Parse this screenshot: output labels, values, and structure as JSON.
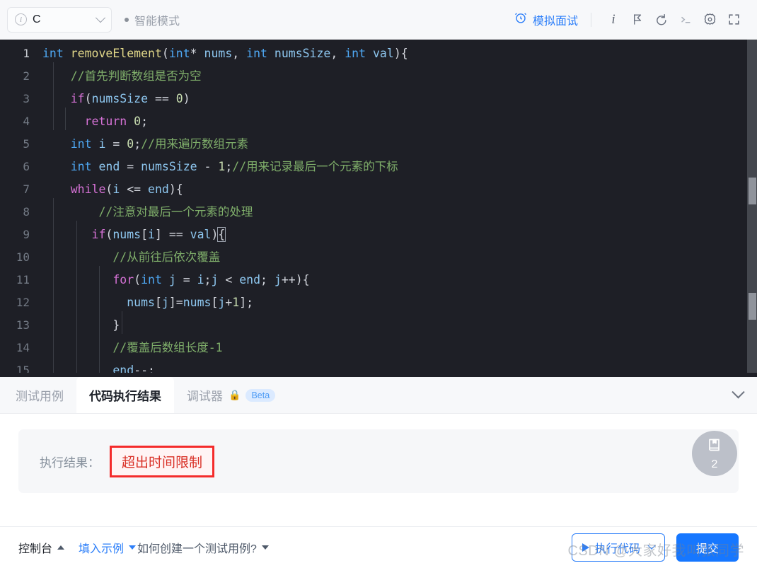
{
  "toolbar": {
    "language": "C",
    "info_icon": "info-circle-icon",
    "dropdown_icon": "chevron-down-icon",
    "mode_label": "智能模式",
    "mock_interview_label": "模拟面试",
    "mock_interview_icon": "alarm-clock-icon",
    "accent_color": "#2d7ff9",
    "icons": [
      {
        "name": "info-italic-icon",
        "glyph": "i"
      },
      {
        "name": "flag-run-icon",
        "glyph": "flag"
      },
      {
        "name": "undo-reset-icon",
        "glyph": "undo"
      },
      {
        "name": "terminal-icon",
        "glyph": ">_"
      },
      {
        "name": "settings-gear-icon",
        "glyph": "gear"
      },
      {
        "name": "fullscreen-icon",
        "glyph": "fullscreen"
      }
    ]
  },
  "editor": {
    "background": "#1e1f26",
    "active_line": 1,
    "lines": [
      {
        "n": "1",
        "tokens": [
          {
            "t": "kw",
            "s": "int"
          },
          {
            "t": "op",
            "s": " "
          },
          {
            "t": "fn",
            "s": "removeElement"
          },
          {
            "t": "punc",
            "s": "("
          },
          {
            "t": "kw",
            "s": "int"
          },
          {
            "t": "op",
            "s": "* "
          },
          {
            "t": "var",
            "s": "nums"
          },
          {
            "t": "punc",
            "s": ", "
          },
          {
            "t": "kw",
            "s": "int"
          },
          {
            "t": "op",
            "s": " "
          },
          {
            "t": "var",
            "s": "numsSize"
          },
          {
            "t": "punc",
            "s": ", "
          },
          {
            "t": "kw",
            "s": "int"
          },
          {
            "t": "op",
            "s": " "
          },
          {
            "t": "var",
            "s": "val"
          },
          {
            "t": "punc",
            "s": "){"
          }
        ]
      },
      {
        "n": "2",
        "tokens": [
          {
            "t": "op",
            "s": "    "
          },
          {
            "t": "cmt",
            "s": "//首先判断数组是否为空"
          }
        ]
      },
      {
        "n": "3",
        "tokens": [
          {
            "t": "op",
            "s": "    "
          },
          {
            "t": "ctl",
            "s": "if"
          },
          {
            "t": "punc",
            "s": "("
          },
          {
            "t": "var",
            "s": "numsSize"
          },
          {
            "t": "op",
            "s": " == "
          },
          {
            "t": "num",
            "s": "0"
          },
          {
            "t": "punc",
            "s": ")"
          }
        ]
      },
      {
        "n": "4",
        "tokens": [
          {
            "t": "op",
            "s": "      "
          },
          {
            "t": "ctl",
            "s": "return"
          },
          {
            "t": "op",
            "s": " "
          },
          {
            "t": "num",
            "s": "0"
          },
          {
            "t": "punc",
            "s": ";"
          }
        ]
      },
      {
        "n": "5",
        "tokens": [
          {
            "t": "op",
            "s": "    "
          },
          {
            "t": "kw",
            "s": "int"
          },
          {
            "t": "op",
            "s": " "
          },
          {
            "t": "var",
            "s": "i"
          },
          {
            "t": "op",
            "s": " = "
          },
          {
            "t": "num",
            "s": "0"
          },
          {
            "t": "punc",
            "s": ";"
          },
          {
            "t": "cmt",
            "s": "//用来遍历数组元素"
          }
        ]
      },
      {
        "n": "6",
        "tokens": [
          {
            "t": "op",
            "s": "    "
          },
          {
            "t": "kw",
            "s": "int"
          },
          {
            "t": "op",
            "s": " "
          },
          {
            "t": "var",
            "s": "end"
          },
          {
            "t": "op",
            "s": " = "
          },
          {
            "t": "var",
            "s": "numsSize"
          },
          {
            "t": "op",
            "s": " - "
          },
          {
            "t": "num",
            "s": "1"
          },
          {
            "t": "punc",
            "s": ";"
          },
          {
            "t": "cmt",
            "s": "//用来记录最后一个元素的下标"
          }
        ]
      },
      {
        "n": "7",
        "tokens": [
          {
            "t": "op",
            "s": "    "
          },
          {
            "t": "ctl",
            "s": "while"
          },
          {
            "t": "punc",
            "s": "("
          },
          {
            "t": "var",
            "s": "i"
          },
          {
            "t": "op",
            "s": " <= "
          },
          {
            "t": "var",
            "s": "end"
          },
          {
            "t": "punc",
            "s": "){"
          }
        ]
      },
      {
        "n": "8",
        "tokens": [
          {
            "t": "op",
            "s": "        "
          },
          {
            "t": "cmt",
            "s": "//注意对最后一个元素的处理"
          }
        ]
      },
      {
        "n": "9",
        "tokens": [
          {
            "t": "op",
            "s": "       "
          },
          {
            "t": "ctl",
            "s": "if"
          },
          {
            "t": "punc",
            "s": "("
          },
          {
            "t": "var",
            "s": "nums"
          },
          {
            "t": "punc",
            "s": "["
          },
          {
            "t": "var",
            "s": "i"
          },
          {
            "t": "punc",
            "s": "]"
          },
          {
            "t": "op",
            "s": " == "
          },
          {
            "t": "var",
            "s": "val"
          },
          {
            "t": "punc",
            "s": ")"
          },
          {
            "t": "box",
            "s": "{"
          }
        ]
      },
      {
        "n": "10",
        "tokens": [
          {
            "t": "op",
            "s": "          "
          },
          {
            "t": "cmt",
            "s": "//从前往后依次覆盖"
          }
        ]
      },
      {
        "n": "11",
        "tokens": [
          {
            "t": "op",
            "s": "          "
          },
          {
            "t": "ctl",
            "s": "for"
          },
          {
            "t": "punc",
            "s": "("
          },
          {
            "t": "kw",
            "s": "int"
          },
          {
            "t": "op",
            "s": " "
          },
          {
            "t": "var",
            "s": "j"
          },
          {
            "t": "op",
            "s": " = "
          },
          {
            "t": "var",
            "s": "i"
          },
          {
            "t": "punc",
            "s": ";"
          },
          {
            "t": "var",
            "s": "j"
          },
          {
            "t": "op",
            "s": " < "
          },
          {
            "t": "var",
            "s": "end"
          },
          {
            "t": "punc",
            "s": "; "
          },
          {
            "t": "var",
            "s": "j"
          },
          {
            "t": "op",
            "s": "++"
          },
          {
            "t": "punc",
            "s": "){"
          }
        ]
      },
      {
        "n": "12",
        "tokens": [
          {
            "t": "op",
            "s": "            "
          },
          {
            "t": "var",
            "s": "nums"
          },
          {
            "t": "punc",
            "s": "["
          },
          {
            "t": "var",
            "s": "j"
          },
          {
            "t": "punc",
            "s": "]"
          },
          {
            "t": "op",
            "s": "="
          },
          {
            "t": "var",
            "s": "nums"
          },
          {
            "t": "punc",
            "s": "["
          },
          {
            "t": "var",
            "s": "j"
          },
          {
            "t": "op",
            "s": "+"
          },
          {
            "t": "num",
            "s": "1"
          },
          {
            "t": "punc",
            "s": "];"
          }
        ]
      },
      {
        "n": "13",
        "tokens": [
          {
            "t": "op",
            "s": "          "
          },
          {
            "t": "punc",
            "s": "}"
          }
        ]
      },
      {
        "n": "14",
        "tokens": [
          {
            "t": "op",
            "s": "          "
          },
          {
            "t": "cmt",
            "s": "//覆盖后数组长度-1"
          }
        ]
      },
      {
        "n": "15",
        "tokens": [
          {
            "t": "op",
            "s": "          "
          },
          {
            "t": "var",
            "s": "end"
          },
          {
            "t": "op",
            "s": "--"
          },
          {
            "t": "punc",
            "s": ";"
          }
        ]
      }
    ]
  },
  "result_panel": {
    "tabs": [
      {
        "label": "测试用例",
        "active": false,
        "name": "tab-testcase"
      },
      {
        "label": "代码执行结果",
        "active": true,
        "name": "tab-run-result"
      },
      {
        "label": "调试器",
        "active": false,
        "name": "tab-debugger",
        "lock": "🔒",
        "badge": "Beta"
      }
    ],
    "collapse_icon": "chevron-down-icon",
    "result_label": "执行结果：",
    "verdict": "超出时间限制",
    "verdict_color": "#d93026",
    "highlight_border_color": "#f42b2b",
    "notebook": {
      "icon": "notebook-bookmark-icon",
      "count": "2"
    }
  },
  "bottombar": {
    "console_label": "控制台",
    "fill_example_label": "填入示例",
    "help_label": "如何创建一个测试用例?",
    "run_label": "执行代码",
    "submit_label": "提交",
    "run_icon": "play-triangle-icon",
    "run_dropdown_icon": "chevron-down-icon"
  },
  "watermark": "CSDN @大家好我叫张同学"
}
